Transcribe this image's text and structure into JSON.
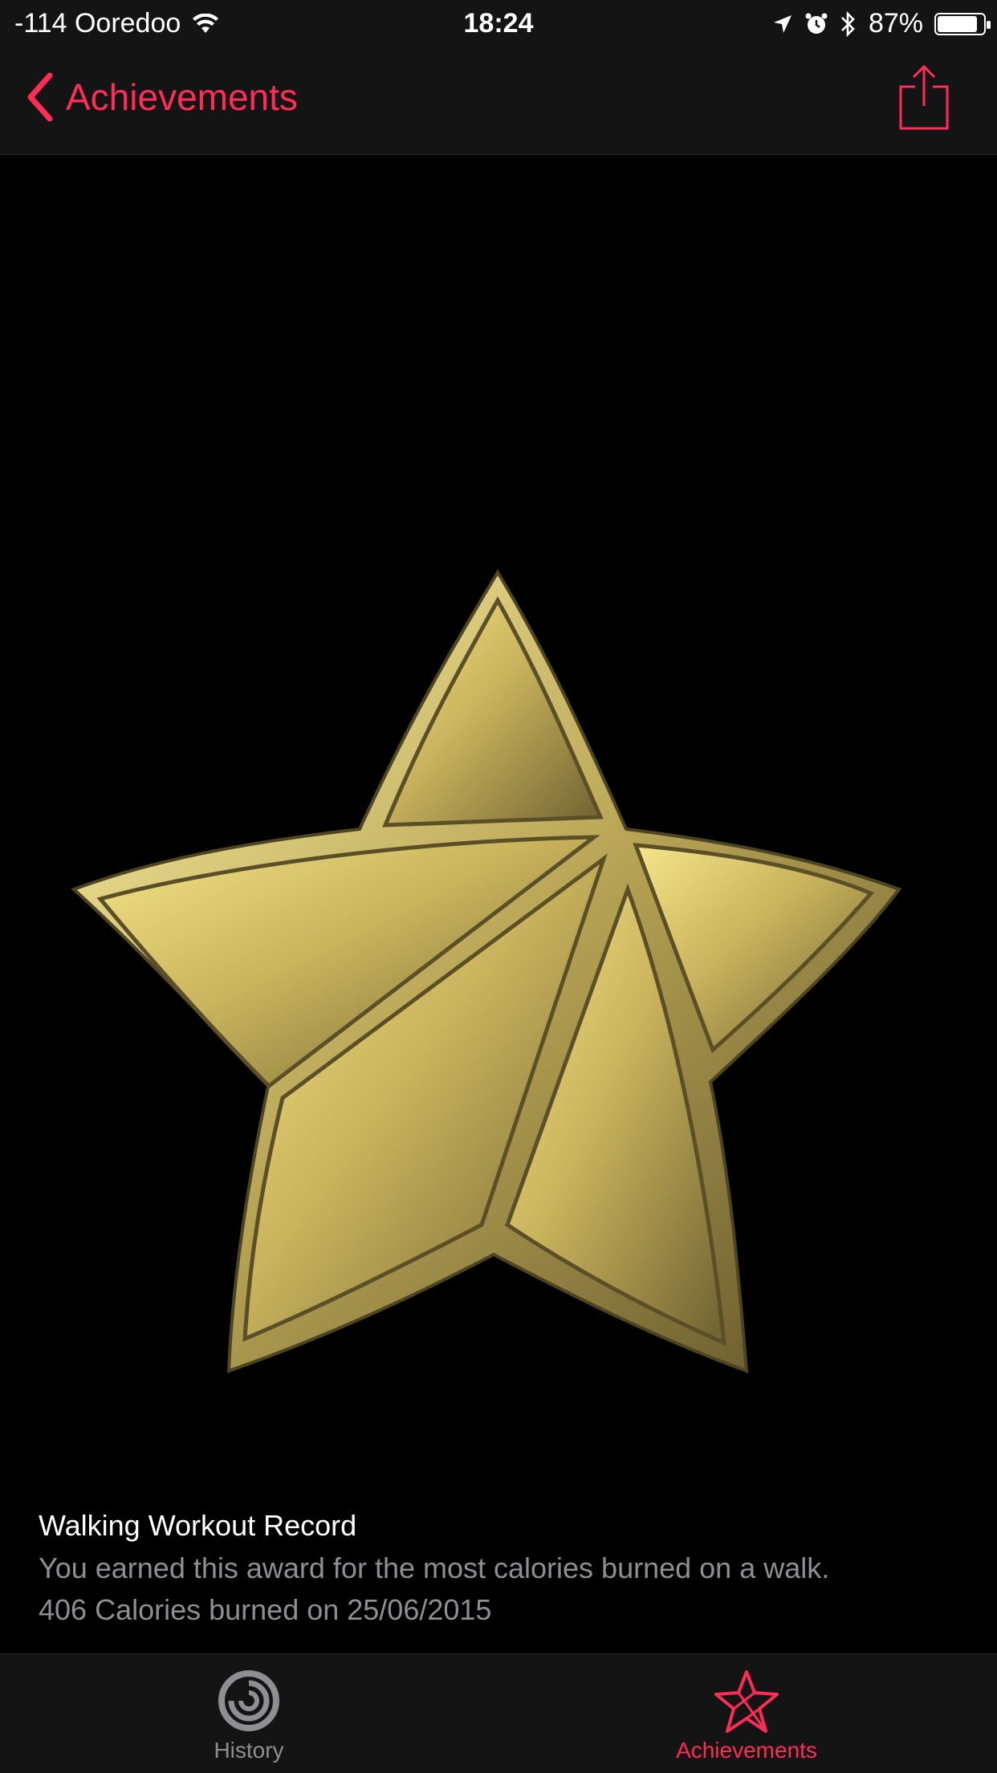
{
  "status_bar": {
    "carrier": "-114 Ooredoo",
    "time": "18:24",
    "battery": "87%",
    "battery_level": 0.87
  },
  "nav": {
    "back_label": "Achievements"
  },
  "award": {
    "title": "Walking Workout Record",
    "description": "You earned this award for the most calories burned on a walk.",
    "detail": "406 Calories burned on 25/06/2015"
  },
  "tabs": [
    {
      "label": "History",
      "icon": "activity-rings-icon",
      "active": false
    },
    {
      "label": "Achievements",
      "icon": "star-icon",
      "active": true
    }
  ],
  "colors": {
    "accent": "#ff2d55",
    "gold": "#d9c46a",
    "inactive": "#8e8e93"
  }
}
